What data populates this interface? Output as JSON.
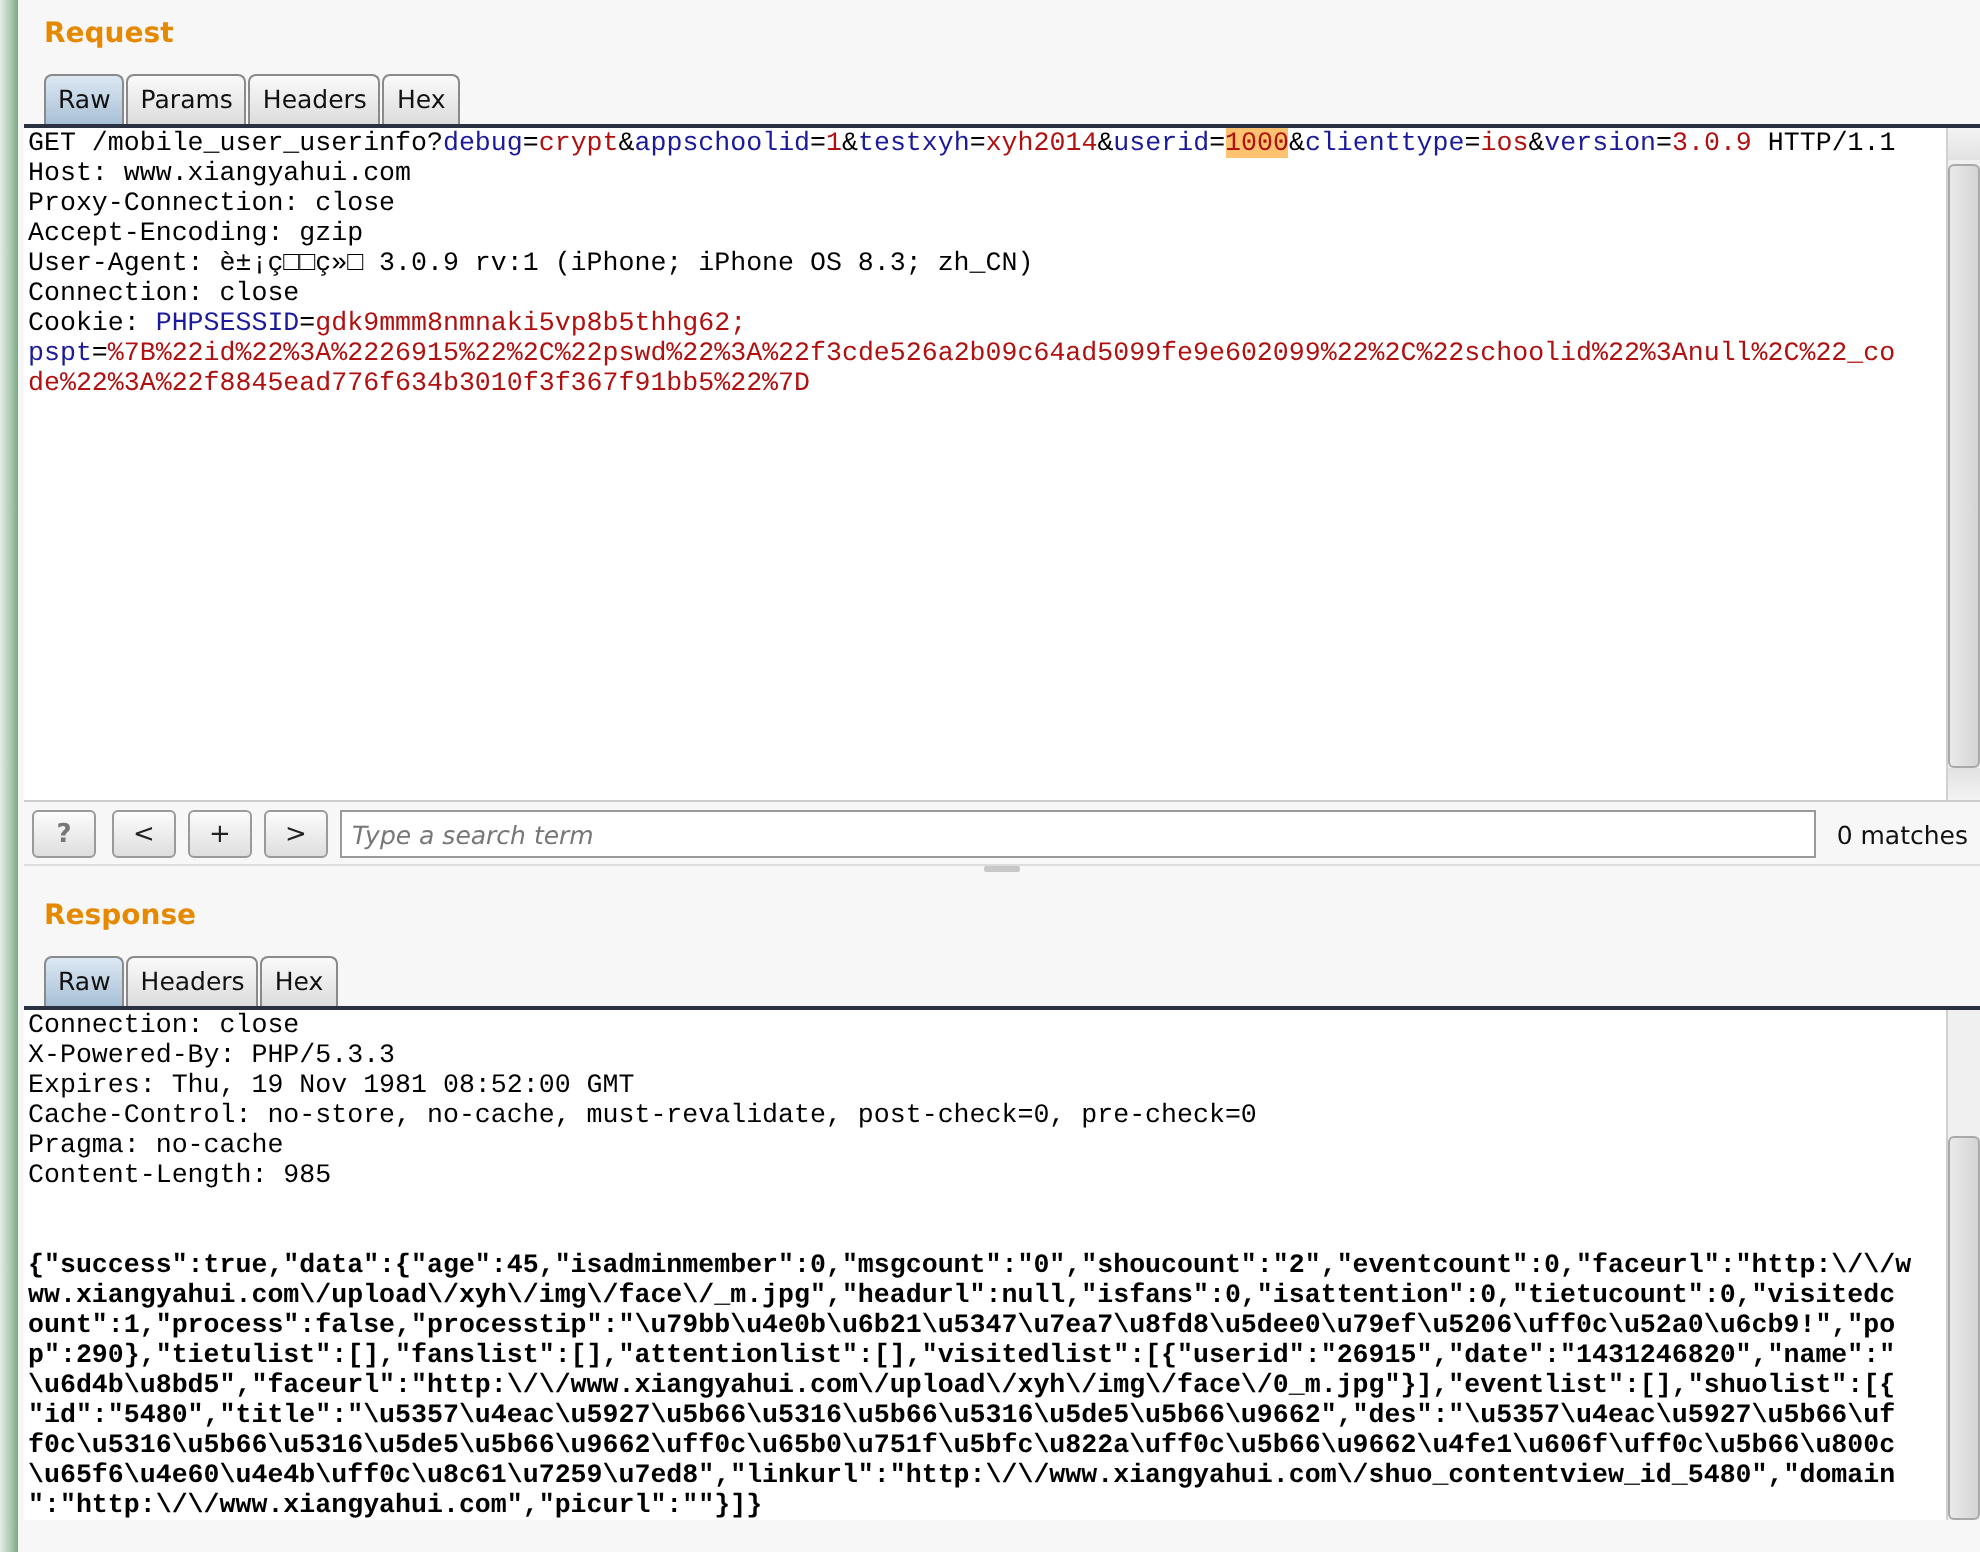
{
  "request": {
    "title": "Request",
    "tabs": [
      {
        "label": "Raw",
        "selected": true
      },
      {
        "label": "Params",
        "selected": false
      },
      {
        "label": "Headers",
        "selected": false
      },
      {
        "label": "Hex",
        "selected": false
      }
    ],
    "lines": [
      [
        {
          "text": "GET /mobile_user_userinfo?",
          "kind": "plain"
        },
        {
          "text": "debug",
          "kind": "param"
        },
        {
          "text": "=",
          "kind": "plain"
        },
        {
          "text": "crypt",
          "kind": "value"
        },
        {
          "text": "&",
          "kind": "plain"
        },
        {
          "text": "appschoolid",
          "kind": "param"
        },
        {
          "text": "=",
          "kind": "plain"
        },
        {
          "text": "1",
          "kind": "value"
        },
        {
          "text": "&",
          "kind": "plain"
        },
        {
          "text": "testxyh",
          "kind": "param"
        },
        {
          "text": "=",
          "kind": "plain"
        },
        {
          "text": "xyh2014",
          "kind": "value"
        },
        {
          "text": "&",
          "kind": "plain"
        },
        {
          "text": "userid",
          "kind": "param"
        },
        {
          "text": "=",
          "kind": "plain"
        },
        {
          "text": "1000",
          "kind": "match"
        },
        {
          "text": "&",
          "kind": "plain"
        },
        {
          "text": "clienttype",
          "kind": "param"
        },
        {
          "text": "=",
          "kind": "plain"
        },
        {
          "text": "ios",
          "kind": "value"
        },
        {
          "text": "&",
          "kind": "plain"
        },
        {
          "text": "version",
          "kind": "param"
        },
        {
          "text": "=",
          "kind": "plain"
        },
        {
          "text": "3.0.9",
          "kind": "value"
        },
        {
          "text": " HTTP/1.1",
          "kind": "plain"
        }
      ],
      [
        {
          "text": "Host: www.xiangyahui.com",
          "kind": "plain"
        }
      ],
      [
        {
          "text": "Proxy-Connection: close",
          "kind": "plain"
        }
      ],
      [
        {
          "text": "Accept-Encoding: gzip",
          "kind": "plain"
        }
      ],
      [
        {
          "text": "User-Agent: è±¡ç□□ç»□ 3.0.9 rv:1 (iPhone; iPhone OS 8.3; zh_CN)",
          "kind": "plain"
        }
      ],
      [
        {
          "text": "Connection: close",
          "kind": "plain"
        }
      ],
      [
        {
          "text": "Cookie: ",
          "kind": "plain"
        },
        {
          "text": "PHPSESSID",
          "kind": "param"
        },
        {
          "text": "=",
          "kind": "plain"
        },
        {
          "text": "gdk9mmm8nmnaki5vp8b5thhg62;",
          "kind": "value"
        }
      ],
      [
        {
          "text": "pspt",
          "kind": "param"
        },
        {
          "text": "=",
          "kind": "plain"
        },
        {
          "text": "%7B%22id%22%3A%2226915%22%2C%22pswd%22%3A%22f3cde526a2b09c64ad5099fe9e602099%22%2C%22schoolid%22%3Anull%2C%22_co",
          "kind": "value"
        }
      ],
      [
        {
          "text": "de%22%3A%22f8845ead776f634b3010f3f367f91bb5%22%7D",
          "kind": "value"
        }
      ]
    ],
    "search": {
      "buttons": [
        "?",
        "<",
        "+",
        ">"
      ],
      "placeholder": "Type a search term",
      "matches": "0 matches"
    }
  },
  "response": {
    "title": "Response",
    "tabs": [
      {
        "label": "Raw",
        "selected": true
      },
      {
        "label": "Headers",
        "selected": false
      },
      {
        "label": "Hex",
        "selected": false
      }
    ],
    "header_lines": [
      "Connection: close",
      "X-Powered-By: PHP/5.3.3",
      "Expires: Thu, 19 Nov 1981 08:52:00 GMT",
      "Cache-Control: no-store, no-cache, must-revalidate, post-check=0, pre-check=0",
      "Pragma: no-cache",
      "Content-Length: 985"
    ],
    "body_lines": [
      "{\"success\":true,\"data\":{\"age\":45,\"isadminmember\":0,\"msgcount\":\"0\",\"shoucount\":\"2\",\"eventcount\":0,\"faceurl\":\"http:\\/\\/w",
      "ww.xiangyahui.com\\/upload\\/xyh\\/img\\/face\\/_m.jpg\",\"headurl\":null,\"isfans\":0,\"isattention\":0,\"tietucount\":0,\"visitedc",
      "ount\":1,\"process\":false,\"processtip\":\"\\u79bb\\u4e0b\\u6b21\\u5347\\u7ea7\\u8fd8\\u5dee0\\u79ef\\u5206\\uff0c\\u52a0\\u6cb9!\",\"po",
      "p\":290},\"tietulist\":[],\"fanslist\":[],\"attentionlist\":[],\"visitedlist\":[{\"userid\":\"26915\",\"date\":\"1431246820\",\"name\":\"",
      "\\u6d4b\\u8bd5\",\"faceurl\":\"http:\\/\\/www.xiangyahui.com\\/upload\\/xyh\\/img\\/face\\/0_m.jpg\"}],\"eventlist\":[],\"shuolist\":[{",
      "\"id\":\"5480\",\"title\":\"\\u5357\\u4eac\\u5927\\u5b66\\u5316\\u5b66\\u5316\\u5de5\\u5b66\\u9662\",\"des\":\"\\u5357\\u4eac\\u5927\\u5b66\\uf",
      "f0c\\u5316\\u5b66\\u5316\\u5de5\\u5b66\\u9662\\uff0c\\u65b0\\u751f\\u5bfc\\u822a\\uff0c\\u5b66\\u9662\\u4fe1\\u606f\\uff0c\\u5b66\\u800c",
      "\\u65f6\\u4e60\\u4e4b\\uff0c\\u8c61\\u7259\\u7ed8\",\"linkurl\":\"http:\\/\\/www.xiangyahui.com\\/shuo_contentview_id_5480\",\"domain",
      "\":\"http:\\/\\/www.xiangyahui.com\",\"picurl\":\"\"}]}"
    ]
  }
}
